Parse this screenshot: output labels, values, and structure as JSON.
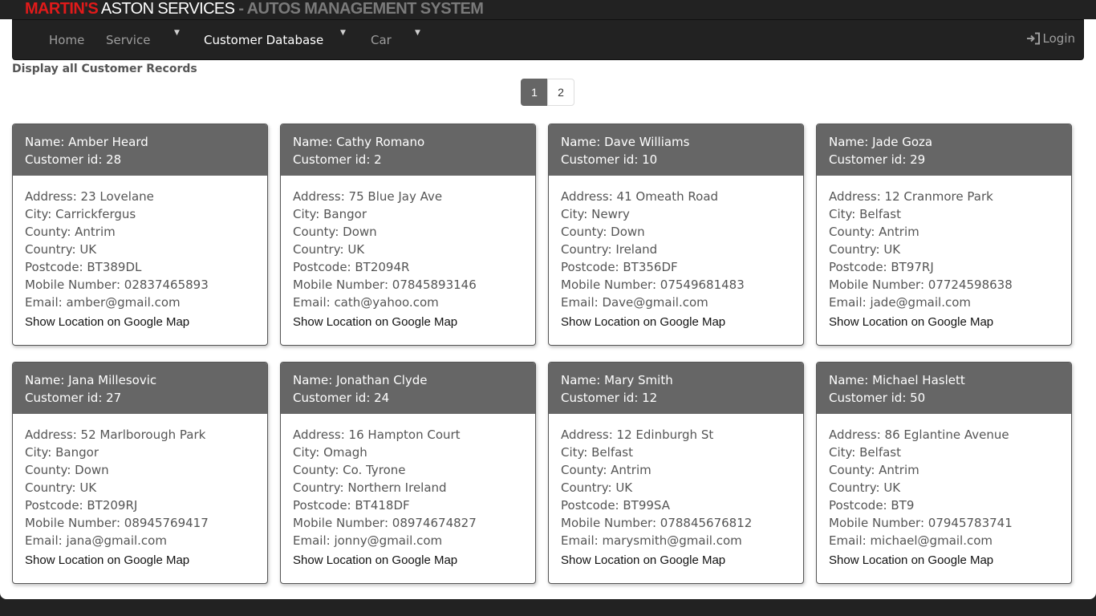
{
  "brand": {
    "part1": "MARTIN'S",
    "part2": " ASTON SERVICES",
    "part3": " - AUTOS MANAGEMENT SYSTEM",
    "accent_color": "#e01a1a"
  },
  "nav": {
    "home": "Home",
    "service": "Service",
    "customer_database": "Customer Database",
    "car": "Car",
    "login": "Login"
  },
  "heading": "Display all Customer Records",
  "pagination": {
    "pages": [
      "1",
      "2"
    ],
    "current": "1"
  },
  "labels": {
    "map_link": "Show Location on Google Map"
  },
  "customers": [
    {
      "name": "Name: Amber Heard",
      "id": "Customer id: 28",
      "address": "Address: 23 Lovelane",
      "city": "City: Carrickfergus",
      "county": "County: Antrim",
      "country": "Country: UK",
      "postcode": "Postcode: BT389DL",
      "mobile": "Mobile Number: 02837465893",
      "email": "Email: amber@gmail.com"
    },
    {
      "name": "Name: Cathy Romano",
      "id": "Customer id: 2",
      "address": "Address: 75 Blue Jay Ave",
      "city": "City: Bangor",
      "county": "County: Down",
      "country": "Country: UK",
      "postcode": "Postcode: BT2094R",
      "mobile": "Mobile Number: 07845893146",
      "email": "Email: cath@yahoo.com"
    },
    {
      "name": "Name: Dave Williams",
      "id": "Customer id: 10",
      "address": "Address: 41 Omeath Road",
      "city": "City: Newry",
      "county": "County: Down",
      "country": "Country: Ireland",
      "postcode": "Postcode: BT356DF",
      "mobile": "Mobile Number: 07549681483",
      "email": "Email: Dave@gmail.com"
    },
    {
      "name": "Name: Jade Goza",
      "id": "Customer id: 29",
      "address": "Address: 12 Cranmore Park",
      "city": "City: Belfast",
      "county": "County: Antrim",
      "country": "Country: UK",
      "postcode": "Postcode: BT97RJ",
      "mobile": "Mobile Number: 07724598638",
      "email": "Email: jade@gmail.com"
    },
    {
      "name": "Name: Jana Millesovic",
      "id": "Customer id: 27",
      "address": "Address: 52 Marlborough Park",
      "city": "City: Bangor",
      "county": "County: Down",
      "country": "Country: UK",
      "postcode": "Postcode: BT209RJ",
      "mobile": "Mobile Number: 08945769417",
      "email": "Email: jana@gmail.com"
    },
    {
      "name": "Name: Jonathan Clyde",
      "id": "Customer id: 24",
      "address": "Address: 16 Hampton Court",
      "city": "City: Omagh",
      "county": "County: Co. Tyrone",
      "country": "Country: Northern Ireland",
      "postcode": "Postcode: BT418DF",
      "mobile": "Mobile Number: 08974674827",
      "email": "Email: jonny@gmail.com"
    },
    {
      "name": "Name: Mary Smith",
      "id": "Customer id: 12",
      "address": "Address: 12 Edinburgh St",
      "city": "City: Belfast",
      "county": "County: Antrim",
      "country": "Country: UK",
      "postcode": "Postcode: BT99SA",
      "mobile": "Mobile Number: 078845676812",
      "email": "Email: marysmith@gmail.com"
    },
    {
      "name": "Name: Michael Haslett",
      "id": "Customer id: 50",
      "address": "Address: 86 Eglantine Avenue",
      "city": "City: Belfast",
      "county": "County: Antrim",
      "country": "Country: UK",
      "postcode": "Postcode: BT9",
      "mobile": "Mobile Number: 07945783741",
      "email": "Email: michael@gmail.com"
    }
  ]
}
